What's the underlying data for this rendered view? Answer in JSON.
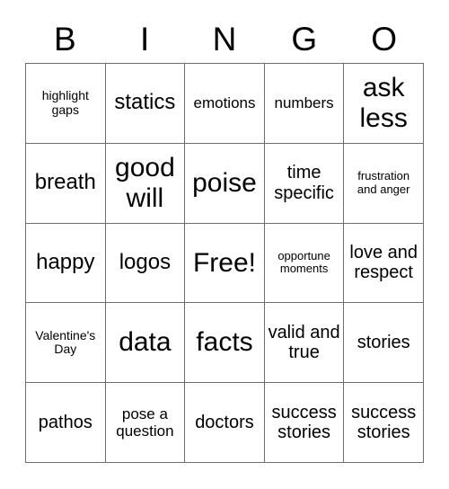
{
  "card": {
    "header_letters": [
      "B",
      "I",
      "N",
      "G",
      "O"
    ],
    "columns": 5,
    "rows": 5,
    "border_color": "#6e6e6e",
    "background_color": "#ffffff",
    "text_color": "#000000",
    "free_space_label": "Free!",
    "cells": [
      {
        "text": "highlight gaps",
        "size": "xs"
      },
      {
        "text": "statics",
        "size": "l"
      },
      {
        "text": "emotions",
        "size": "s"
      },
      {
        "text": "numbers",
        "size": "s"
      },
      {
        "text": "ask less",
        "size": "xxl"
      },
      {
        "text": "breath",
        "size": "l"
      },
      {
        "text": "good will",
        "size": "xxl"
      },
      {
        "text": "poise",
        "size": "xxl"
      },
      {
        "text": "time specific",
        "size": "m"
      },
      {
        "text": "frustration and anger",
        "size": "xxs"
      },
      {
        "text": "happy",
        "size": "l"
      },
      {
        "text": "logos",
        "size": "l"
      },
      {
        "text": "Free!",
        "size": "xxl"
      },
      {
        "text": "opportune moments",
        "size": "xxs"
      },
      {
        "text": "love and respect",
        "size": "m"
      },
      {
        "text": "Valentine's Day",
        "size": "xs"
      },
      {
        "text": "data",
        "size": "xxl"
      },
      {
        "text": "facts",
        "size": "xxl"
      },
      {
        "text": "valid and true",
        "size": "m"
      },
      {
        "text": "stories",
        "size": "m"
      },
      {
        "text": "pathos",
        "size": "m"
      },
      {
        "text": "pose a question",
        "size": "s"
      },
      {
        "text": "doctors",
        "size": "m"
      },
      {
        "text": "success stories",
        "size": "m"
      },
      {
        "text": "success stories",
        "size": "m"
      }
    ]
  }
}
